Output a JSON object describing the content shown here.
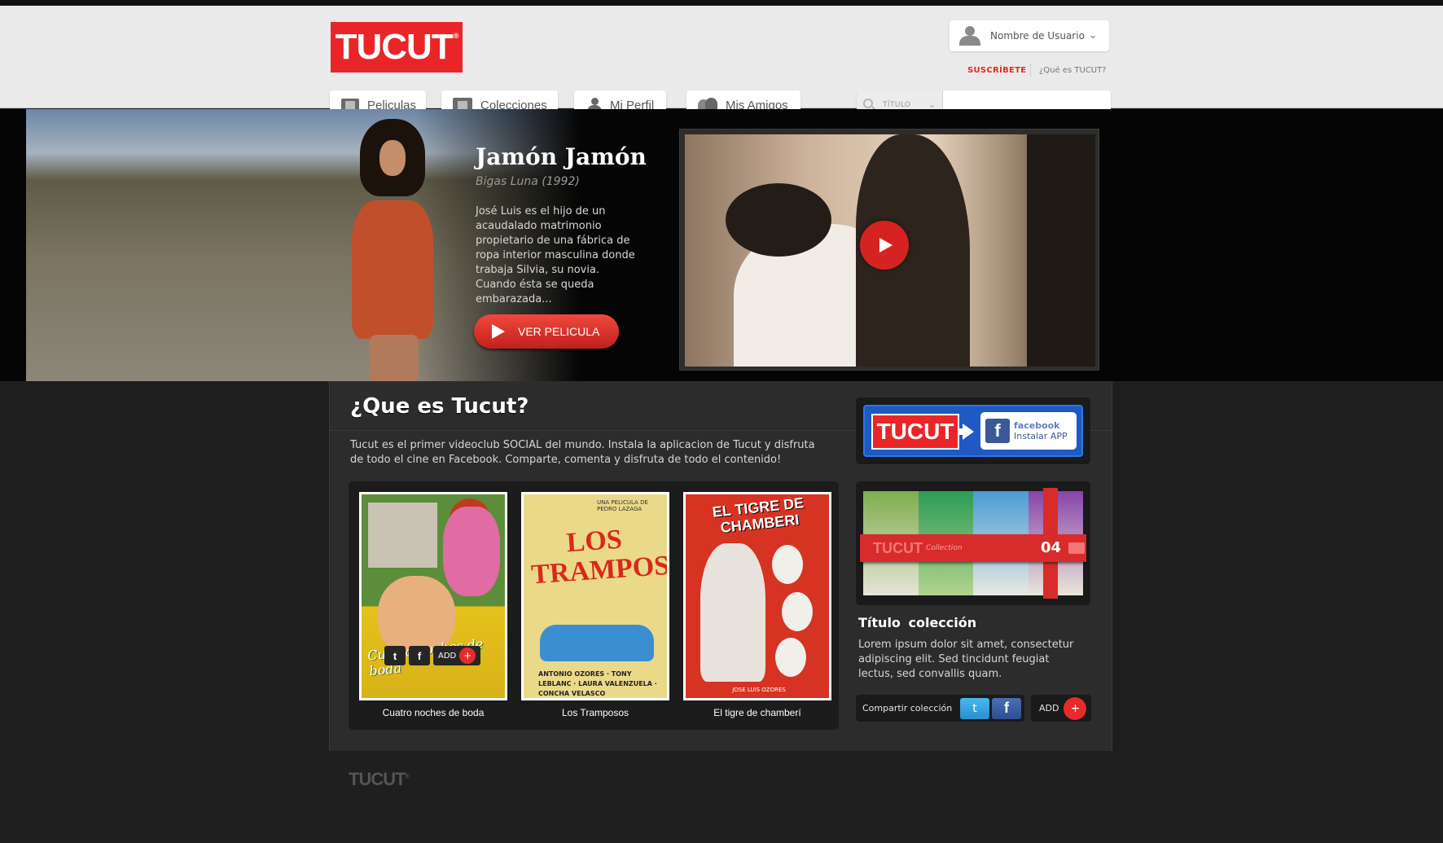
{
  "brand": {
    "logo": "TUCUT",
    "registered": "®",
    "accent": "#ea2527"
  },
  "user": {
    "name": "Nombre de Usuario"
  },
  "header_links": {
    "subscribe": "SUSCRÍBETE",
    "about": "¿Qué es TUCUT?"
  },
  "nav": {
    "tabs": [
      {
        "label": "Peliculas",
        "icon": "film-icon"
      },
      {
        "label": "Colecciones",
        "icon": "collections-icon"
      },
      {
        "label": "Mi Perfil",
        "icon": "person-icon"
      },
      {
        "label": "Mis Amigos",
        "icon": "friends-icon"
      }
    ]
  },
  "search": {
    "filter_label": "TÍTULO",
    "placeholder": ""
  },
  "hero": {
    "title": "Jamón Jamón",
    "subtitle": "Bigas Luna (1992)",
    "description": "José Luis es el hijo de un acaudalado matrimonio propietario de una fábrica de ropa interior masculina donde trabaja Silvia, su novia. Cuando ésta se queda embarazada...",
    "cta": "VER PELICULA"
  },
  "about": {
    "title": "¿Que es Tucut?",
    "description": "Tucut es el primer videoclub SOCIAL del mundo. Instala la aplicacion de Tucut y disfruta de todo el cine en Facebook. Comparte, comenta y disfruta de todo el contenido!"
  },
  "facebook_app": {
    "brand": "facebook",
    "label": "Instalar APP"
  },
  "movies": [
    {
      "title": "Cuatro noches de boda",
      "poster_text": "Cuatro noches de boda"
    },
    {
      "title": "Los Tramposos",
      "poster_text": "LOS TRAMPOSOS",
      "poster_tag": "UNA PELICULA DE PEDRO LAZAGA",
      "poster_names": "ANTONIO OZORES · TONY LEBLANC · LAURA VALENZUELA · CONCHA VELASCO"
    },
    {
      "title": "El tigre de chamberí",
      "poster_text": "EL TIGRE DE CHAMBERI",
      "poster_names": "JOSE LUIS OZORES"
    }
  ],
  "movie_actions": {
    "add_label": "ADD",
    "twitter": "t",
    "facebook": "f",
    "plus": "+"
  },
  "collection": {
    "ribbon_logo": "TUCUT",
    "ribbon_sub": "Collection",
    "count": "04",
    "title": "Título  colección",
    "description": "Lorem ipsum dolor sit amet, consectetur adipiscing elit. Sed tincidunt feugiat lectus, sed convallis quam.",
    "share_label": "Compartir colección",
    "add_label": "ADD"
  },
  "footer": {
    "logo": "TUCUT"
  }
}
